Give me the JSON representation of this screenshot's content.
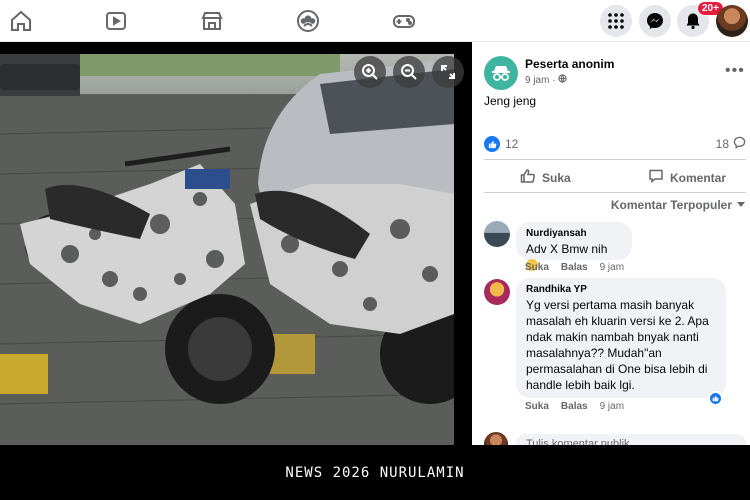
{
  "topnav": {
    "icons": [
      "home-icon",
      "watch-icon",
      "marketplace-icon",
      "groups-icon",
      "gaming-icon"
    ],
    "right_icons": [
      "menu-grid-icon",
      "messenger-icon",
      "notifications-icon"
    ],
    "notification_badge": "20+"
  },
  "photo": {
    "controls": [
      "zoom-in-icon",
      "zoom-out-icon",
      "fullscreen-icon"
    ],
    "subject": "camouflaged scooters"
  },
  "caption": "NEWS 2026 NURULAMIN",
  "post": {
    "author": "Peserta anonim",
    "time": "9 jam",
    "privacy_icon": "globe-icon",
    "text": "Jeng jeng",
    "like_count": "12",
    "comment_count": "18",
    "like_label": "Suka",
    "comment_label": "Komentar",
    "sort_label": "Komentar Terpopuler"
  },
  "comments": [
    {
      "name": "Nurdiyansah",
      "text": "Adv X Bmw nih",
      "like_label": "Suka",
      "reply_label": "Balas",
      "time": "9 jam"
    },
    {
      "name": "Randhika YP",
      "text": "Yg versi pertama masih banyak masalah eh kluarin versi ke 2. Apa ndak makin nambah bnyak nanti masalahnya?? Mudah\"an permasalahan di One bisa lebih di handle lebih baik lgi.",
      "like_label": "Suka",
      "reply_label": "Balas",
      "time": "9 jam"
    }
  ],
  "comment_input": {
    "placeholder": "Tulis komentar publik..."
  },
  "colors": {
    "accent": "#1877f2",
    "anon_avatar": "#3fb5a1",
    "badge": "#e41e3f"
  }
}
